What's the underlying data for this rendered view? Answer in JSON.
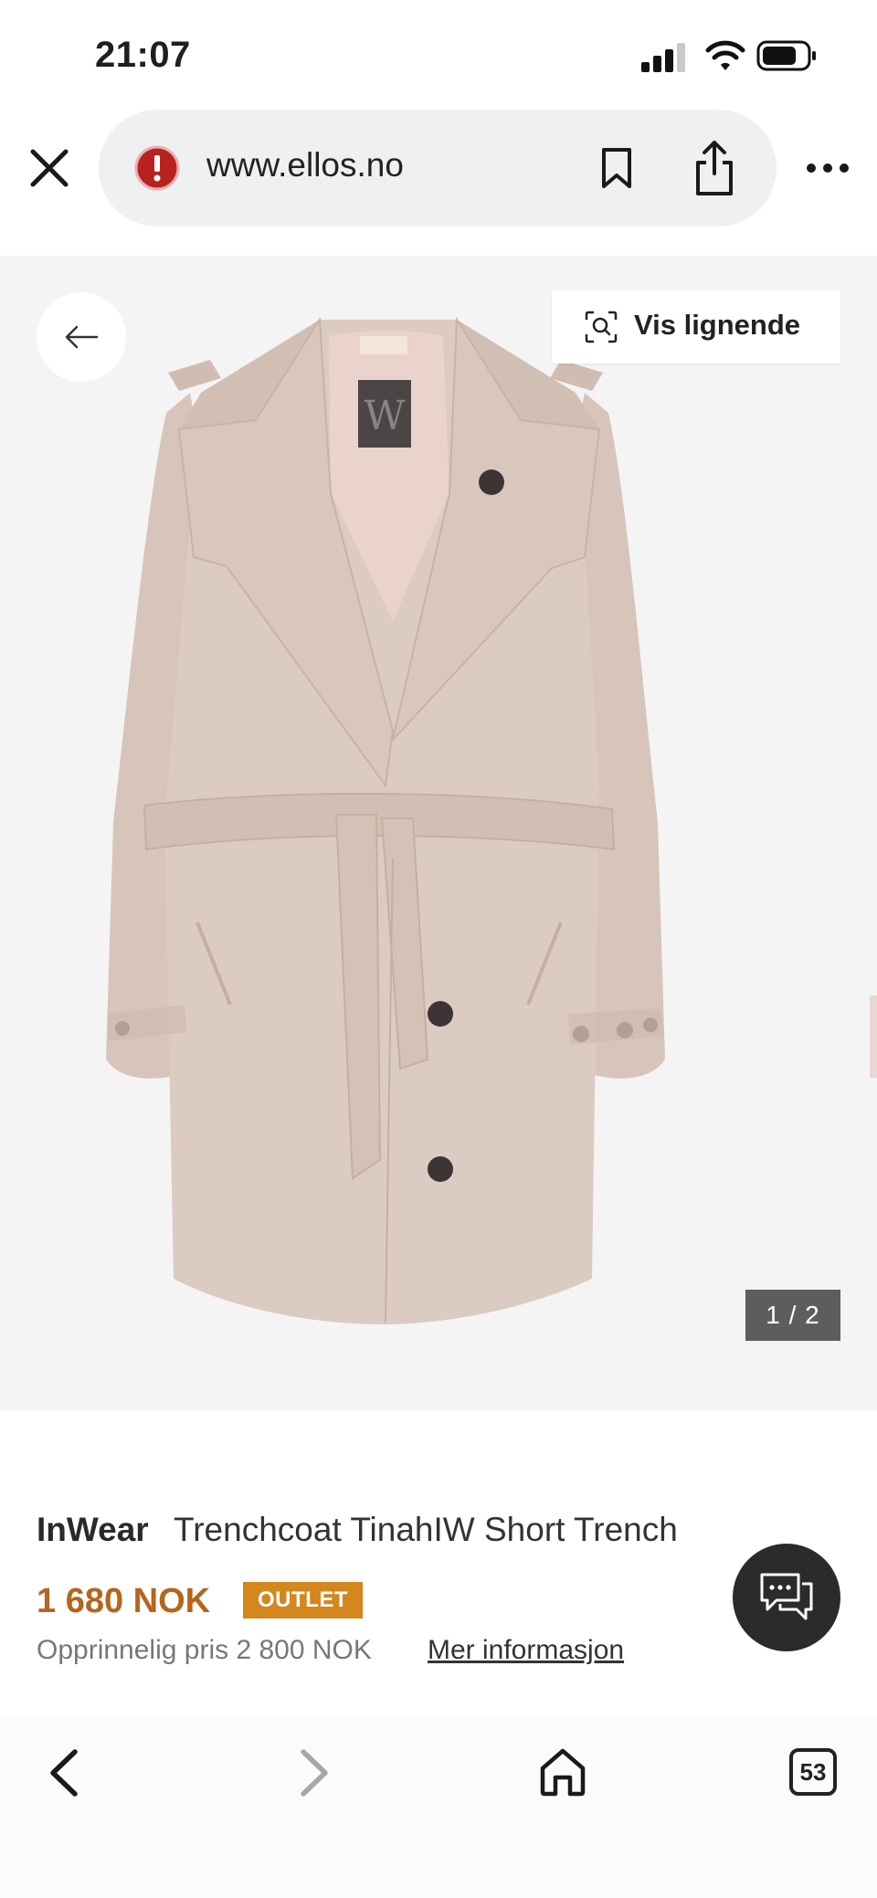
{
  "status_bar": {
    "time": "21:07"
  },
  "browser": {
    "url": "www.ellos.no",
    "tab_count": "53"
  },
  "product_image": {
    "similar_label": "Vis lignende",
    "counter": "1 / 2"
  },
  "product": {
    "brand": "InWear",
    "name": "Trenchcoat TinahIW Short Trench",
    "price": "1 680 NOK",
    "badge": "OUTLET",
    "original_price": "Opprinnelig pris 2 800 NOK",
    "more_info": "Mer informasjon"
  },
  "colors": {
    "price": "#b5651d",
    "badge": "#d3871d",
    "coat": "#dccbc2"
  },
  "icons": {
    "status": [
      "signal-icon",
      "wifi-icon",
      "battery-icon"
    ],
    "toolbar": [
      "close-icon",
      "warning-icon",
      "bookmark-icon",
      "share-icon",
      "more-icon"
    ],
    "nav": [
      "back-arrow-icon",
      "forward-arrow-icon",
      "home-icon",
      "tabs-icon"
    ]
  }
}
